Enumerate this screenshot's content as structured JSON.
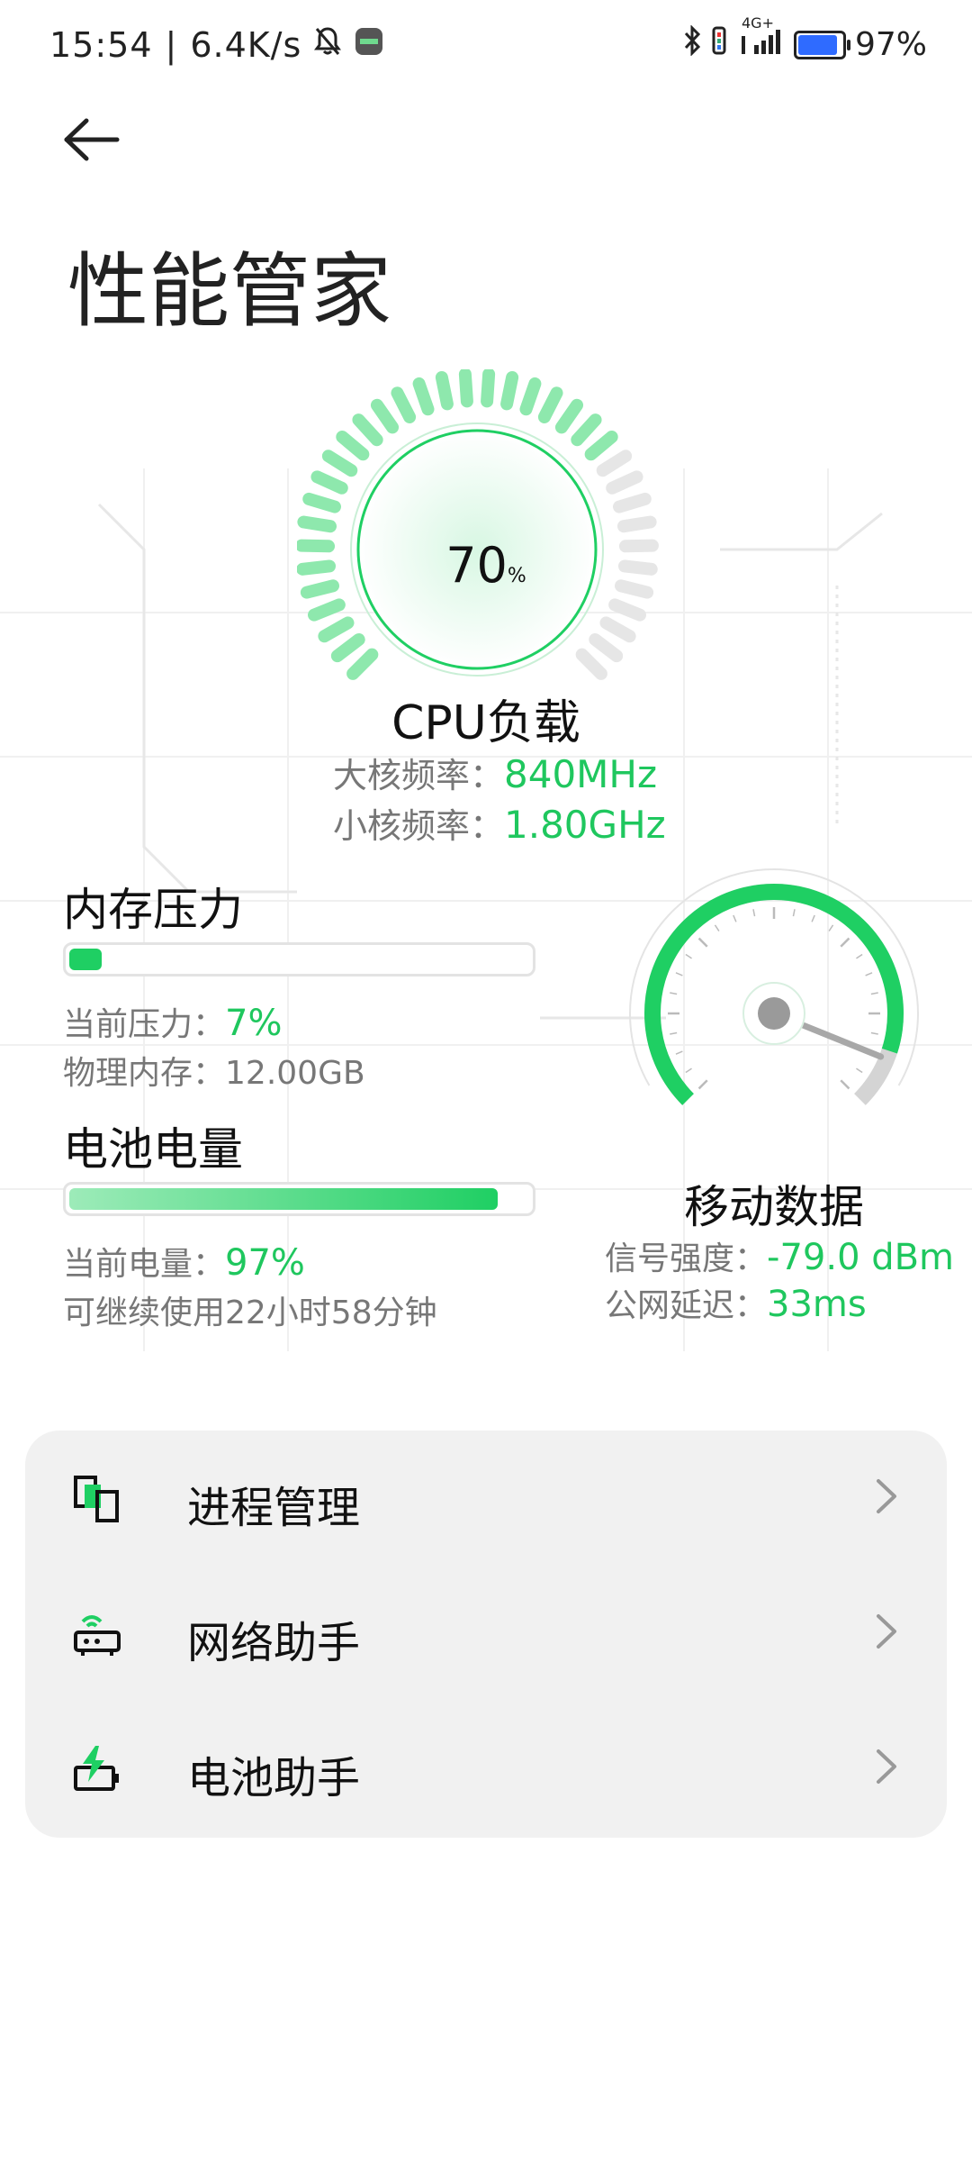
{
  "status_bar": {
    "time": "15:54",
    "separator": "|",
    "net_speed": "6.4K/s",
    "network_type": "4G+",
    "battery": "97%",
    "icons": [
      "bell-off-icon",
      "app-icon",
      "bluetooth-icon",
      "signal-icon",
      "battery-icon"
    ]
  },
  "page": {
    "title": "性能管家",
    "back_icon": "back-arrow-icon"
  },
  "cpu": {
    "load_value": "70",
    "load_unit": "%",
    "load_fraction": 0.7,
    "label": "CPU负载",
    "big_core_label": "大核频率：",
    "big_core_value": "840MHz",
    "small_core_label": "小核频率：",
    "small_core_value": "1.80GHz"
  },
  "memory": {
    "title": "内存压力",
    "pressure_fraction": 0.07,
    "pressure_label": "当前压力：",
    "pressure_value": "7%",
    "physical_label": "物理内存：",
    "physical_value": "12.00GB"
  },
  "battery": {
    "title": "电池电量",
    "level_fraction": 0.97,
    "level_label": "当前电量：",
    "level_value": "97%",
    "remaining_text": "可继续使用22小时58分钟"
  },
  "mobile_data": {
    "label": "移动数据",
    "signal_label": "信号强度：",
    "signal_value": "-79.0 dBm",
    "latency_label": "公网延迟：",
    "latency_value": "33ms"
  },
  "menu": [
    {
      "label": "进程管理",
      "icon": "process-manage-icon"
    },
    {
      "label": "网络助手",
      "icon": "router-icon"
    },
    {
      "label": "电池助手",
      "icon": "battery-charge-icon"
    }
  ],
  "colors": {
    "accent": "#1fcf63",
    "accent_light": "#8ee8ad",
    "track": "#e6e6e6",
    "card_bg": "#f1f1f1"
  }
}
